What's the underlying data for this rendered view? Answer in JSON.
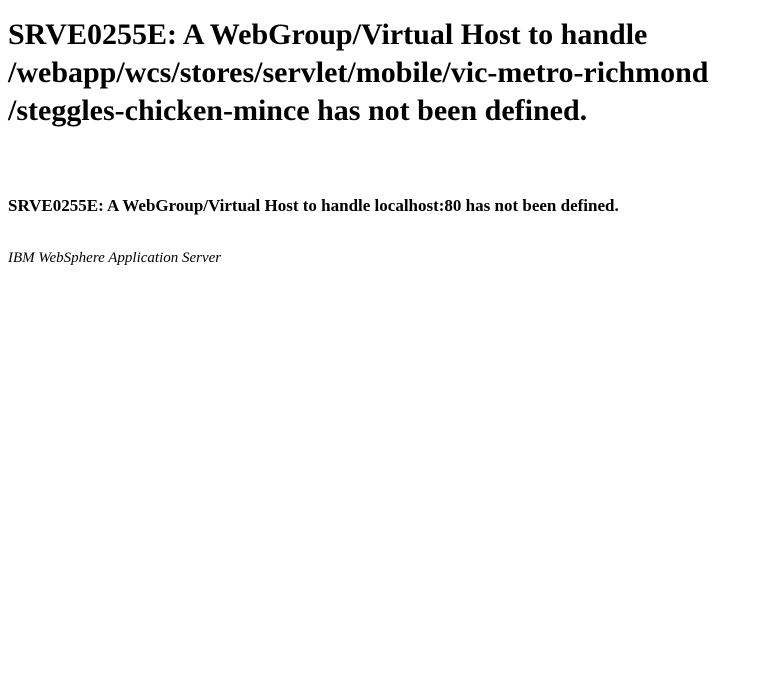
{
  "error_page": {
    "heading_line_1": "SRVE0255E: A WebGroup/Virtual Host to handle",
    "heading_line_2": "/webapp/wcs/stores/servlet/mobile/vic-metro-richmond",
    "heading_line_3": "/steggles-chicken-mince has not been defined.",
    "subheading": "SRVE0255E: A WebGroup/Virtual Host to handle localhost:80 has not been defined.",
    "server_signature": "IBM WebSphere Application Server"
  }
}
